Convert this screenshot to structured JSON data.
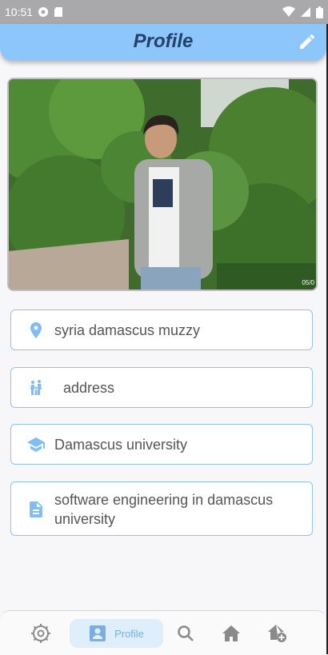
{
  "status_bar": {
    "time": "10:51"
  },
  "appbar": {
    "title": "Profile"
  },
  "profile": {
    "photo_date": "05/0",
    "location": "syria damascus muzzy",
    "address": "address",
    "education": "Damascus university",
    "description": "software engineering in damascus university"
  },
  "bottom_nav": {
    "profile_label": "Profile"
  },
  "colors": {
    "accent": "#8cc6fb",
    "title": "#24416e",
    "icon": "#7fbdf3",
    "nav_active_bg": "#deeefb"
  }
}
